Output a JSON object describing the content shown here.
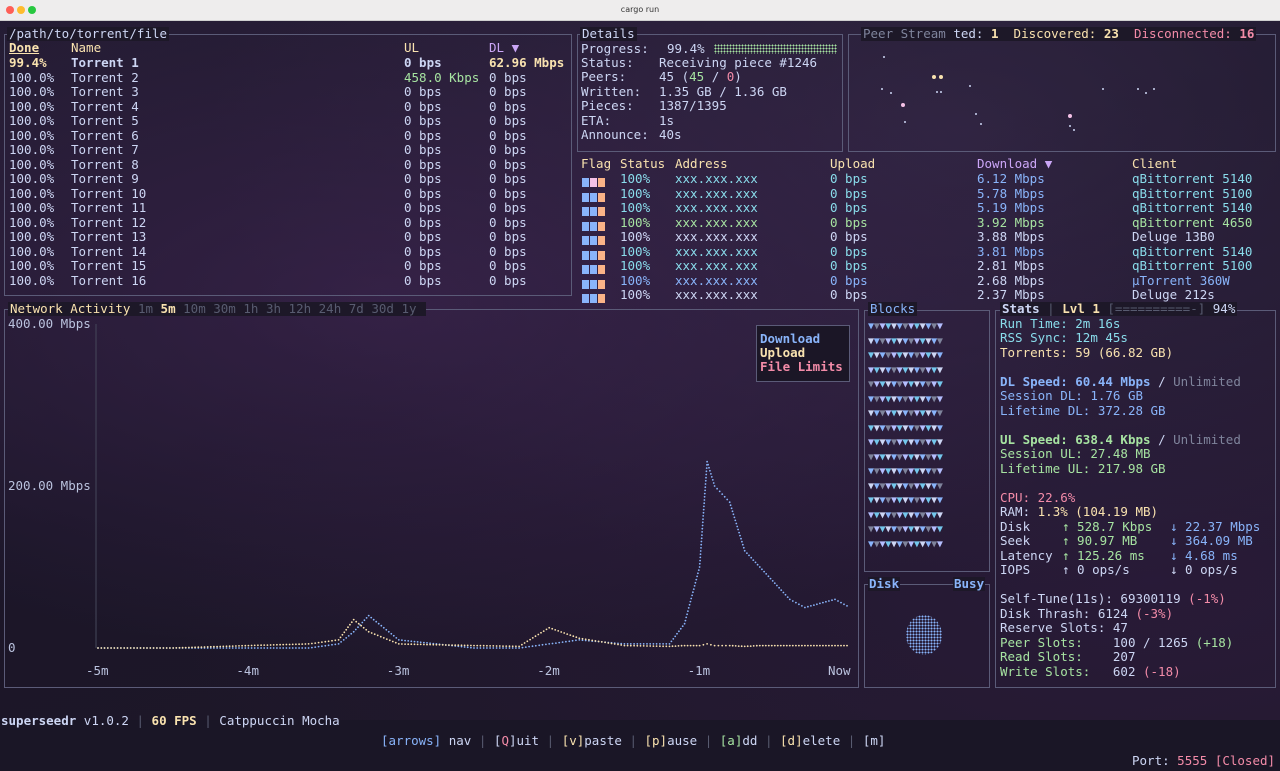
{
  "window": {
    "title": "cargo run"
  },
  "torrents": {
    "path": "/path/to/torrent/file",
    "headers": {
      "done": "Done",
      "name": "Name",
      "ul": "UL",
      "dl": "DL ▼"
    },
    "rows": [
      {
        "done": "99.4%",
        "name": "Torrent 1",
        "ul": "0 bps",
        "dl": "62.96 Mbps"
      },
      {
        "done": "100.0%",
        "name": "Torrent 2",
        "ul": "458.0 Kbps",
        "dl": "0 bps"
      },
      {
        "done": "100.0%",
        "name": "Torrent 3",
        "ul": "0 bps",
        "dl": "0 bps"
      },
      {
        "done": "100.0%",
        "name": "Torrent 4",
        "ul": "0 bps",
        "dl": "0 bps"
      },
      {
        "done": "100.0%",
        "name": "Torrent 5",
        "ul": "0 bps",
        "dl": "0 bps"
      },
      {
        "done": "100.0%",
        "name": "Torrent 6",
        "ul": "0 bps",
        "dl": "0 bps"
      },
      {
        "done": "100.0%",
        "name": "Torrent 7",
        "ul": "0 bps",
        "dl": "0 bps"
      },
      {
        "done": "100.0%",
        "name": "Torrent 8",
        "ul": "0 bps",
        "dl": "0 bps"
      },
      {
        "done": "100.0%",
        "name": "Torrent 9",
        "ul": "0 bps",
        "dl": "0 bps"
      },
      {
        "done": "100.0%",
        "name": "Torrent 10",
        "ul": "0 bps",
        "dl": "0 bps"
      },
      {
        "done": "100.0%",
        "name": "Torrent 11",
        "ul": "0 bps",
        "dl": "0 bps"
      },
      {
        "done": "100.0%",
        "name": "Torrent 12",
        "ul": "0 bps",
        "dl": "0 bps"
      },
      {
        "done": "100.0%",
        "name": "Torrent 13",
        "ul": "0 bps",
        "dl": "0 bps"
      },
      {
        "done": "100.0%",
        "name": "Torrent 14",
        "ul": "0 bps",
        "dl": "0 bps"
      },
      {
        "done": "100.0%",
        "name": "Torrent 15",
        "ul": "0 bps",
        "dl": "0 bps"
      },
      {
        "done": "100.0%",
        "name": "Torrent 16",
        "ul": "0 bps",
        "dl": "0 bps"
      }
    ]
  },
  "details": {
    "title": "Details",
    "progress_label": "Progress:",
    "progress_value": "99.4%",
    "progress_fraction": 0.994,
    "status_label": "Status:",
    "status_value": "Receiving piece #1246",
    "peers_label": "Peers:",
    "peers_a": "45",
    "peers_b": "45",
    "peers_c": "0",
    "written_label": "Written:",
    "written_value": "1.35 GB / 1.36 GB",
    "pieces_label": "Pieces:",
    "pieces_value": "1387/1395",
    "eta_label": "ETA:",
    "eta_value": "1s",
    "announce_label": "Announce:",
    "announce_value": "40s"
  },
  "peer_stream": {
    "title_prefix": "Peer Stream ",
    "connected_label": "ted:",
    "connected_value": "1",
    "discovered_label": "Discovered:",
    "discovered_value": "23",
    "disconnected_label": "Disconnected:",
    "disconnected_value": "16"
  },
  "peers_table": {
    "headers": {
      "flag": "Flag",
      "status": "Status",
      "address": "Address",
      "upload": "Upload",
      "download": "Download ▼",
      "client": "Client"
    },
    "rows": [
      {
        "status": "100%",
        "address": "xxx.xxx.xxx",
        "upload": "0 bps",
        "download": "6.12 Mbps",
        "client": "qBittorrent 5140"
      },
      {
        "status": "100%",
        "address": "xxx.xxx.xxx",
        "upload": "0 bps",
        "download": "5.78 Mbps",
        "client": "qBittorrent 5100"
      },
      {
        "status": "100%",
        "address": "xxx.xxx.xxx",
        "upload": "0 bps",
        "download": "5.19 Mbps",
        "client": "qBittorrent 5140"
      },
      {
        "status": "100%",
        "address": "xxx.xxx.xxx",
        "upload": "0 bps",
        "download": "3.92 Mbps",
        "client": "qBittorrent 4650"
      },
      {
        "status": "100%",
        "address": "xxx.xxx.xxx",
        "upload": "0 bps",
        "download": "3.88 Mbps",
        "client": "Deluge 13B0"
      },
      {
        "status": "100%",
        "address": "xxx.xxx.xxx",
        "upload": "0 bps",
        "download": "3.81 Mbps",
        "client": "qBittorrent 5140"
      },
      {
        "status": "100%",
        "address": "xxx.xxx.xxx",
        "upload": "0 bps",
        "download": "2.81 Mbps",
        "client": "qBittorrent 5100"
      },
      {
        "status": "100%",
        "address": "xxx.xxx.xxx",
        "upload": "0 bps",
        "download": "2.68 Mbps",
        "client": "µTorrent 360W"
      },
      {
        "status": "100%",
        "address": "xxx.xxx.xxx",
        "upload": "0 bps",
        "download": "2.37 Mbps",
        "client": "Deluge 212s"
      }
    ],
    "client_colors": [
      "#89dceb",
      "#89dceb",
      "#89dceb",
      "#a6e3a1",
      "#cdd6f4",
      "#89dceb",
      "#89dceb",
      "#89b4fa",
      "#cdd6f4"
    ],
    "download_colors": [
      "#89b4fa",
      "#89b4fa",
      "#89b4fa",
      "#a6e3a1",
      "#cdd6f4",
      "#89b4fa",
      "#cdd6f4",
      "#cdd6f4",
      "#cdd6f4"
    ]
  },
  "network": {
    "title": "Network Activity",
    "ranges": [
      "1m",
      "5m",
      "10m",
      "30m",
      "1h",
      "3h",
      "12h",
      "24h",
      "7d",
      "30d",
      "1y"
    ],
    "active_range": "5m",
    "legend": {
      "download": "Download",
      "upload": "Upload",
      "file_limits": "File Limits"
    }
  },
  "chart_data": {
    "type": "line",
    "xlabel": "",
    "ylabel": "",
    "x_ticks": [
      "-5m",
      "-4m",
      "-3m",
      "-2m",
      "-1m",
      "Now"
    ],
    "y_ticks": [
      "400.00 Mbps",
      "200.00 Mbps",
      "0"
    ],
    "ylim": [
      0,
      400
    ],
    "x_minutes": [
      -5.0,
      -4.5,
      -4.0,
      -3.6,
      -3.4,
      -3.3,
      -3.2,
      -3.0,
      -2.5,
      -2.2,
      -2.0,
      -1.8,
      -1.5,
      -1.2,
      -1.1,
      -1.0,
      -0.95,
      -0.9,
      -0.85,
      -0.8,
      -0.7,
      -0.6,
      -0.5,
      -0.4,
      -0.3,
      -0.2,
      -0.1,
      0.0
    ],
    "series": [
      {
        "name": "Download",
        "color": "#89b4fa",
        "values": [
          0,
          0,
          0,
          0,
          5,
          20,
          40,
          10,
          0,
          0,
          5,
          10,
          5,
          5,
          30,
          100,
          230,
          200,
          190,
          180,
          120,
          100,
          80,
          60,
          50,
          55,
          60,
          50
        ]
      },
      {
        "name": "Upload",
        "color": "#f9e2af",
        "values": [
          0,
          0,
          3,
          5,
          10,
          35,
          20,
          5,
          3,
          2,
          25,
          12,
          3,
          2,
          3,
          3,
          5,
          3,
          3,
          3,
          2,
          3,
          3,
          3,
          3,
          3,
          3,
          3
        ]
      }
    ]
  },
  "blocks": {
    "title": "Blocks",
    "glyph": "▼"
  },
  "disk_panel": {
    "left": "Disk",
    "right": "Busy"
  },
  "stats": {
    "title": "Stats",
    "lvl": "Lvl 1",
    "lvl_bar": "[==========-]",
    "lvl_pct": "94%",
    "run_time_label": "Run Time:",
    "run_time": "2m 16s",
    "rss_label": "RSS Sync:",
    "rss": "12m 45s",
    "torrents_label": "Torrents:",
    "torrents": "59 (66.82 GB)",
    "dl_speed_label": "DL Speed:",
    "dl_speed": "60.44 Mbps",
    "dl_limit": "Unlimited",
    "session_dl_label": "Session DL:",
    "session_dl": "1.76 GB",
    "lifetime_dl_label": "Lifetime DL:",
    "lifetime_dl": "372.28 GB",
    "ul_speed_label": "UL Speed:",
    "ul_speed": "638.4 Kbps",
    "ul_limit": "Unlimited",
    "session_ul_label": "Session UL:",
    "session_ul": "27.48 MB",
    "lifetime_ul_label": "Lifetime UL:",
    "lifetime_ul": "217.98 GB",
    "cpu_label": "CPU:",
    "cpu": "22.6%",
    "ram_label": "RAM:",
    "ram": "1.3% (104.19 MB)",
    "disk_label": "Disk",
    "disk_up": "↑ 528.7 Kbps",
    "disk_down": "↓ 22.37 Mbps",
    "seek_label": "Seek",
    "seek_up": "↑ 90.97 MB",
    "seek_down": "↓ 364.09 MB",
    "latency_label": "Latency",
    "latency_up": "↑ 125.26 ms",
    "latency_down": "↓ 4.68 ms",
    "iops_label": "IOPS",
    "iops_up": "↑ 0 ops/s",
    "iops_down": "↓ 0 ops/s",
    "selftune_label": "Self-Tune(11s):",
    "selftune": "69300119",
    "selftune_delta": "(-1%)",
    "thrash_label": "Disk Thrash:",
    "thrash": "6124",
    "thrash_delta": "(-3%)",
    "reserve_label": "Reserve Slots:",
    "reserve": "47",
    "peer_slots_label": "Peer Slots:",
    "peer_slots": "100 / 1265",
    "peer_slots_delta": "(+18)",
    "read_slots_label": "Read Slots:",
    "read_slots": "207",
    "write_slots_label": "Write Slots:",
    "write_slots": "602",
    "write_slots_delta": "(-18)"
  },
  "statusbar": {
    "app": "superseedr",
    "version": "v1.0.2",
    "fps": "60 FPS",
    "theme": "Catppuccin Mocha",
    "k_arrows": "[arrows]",
    "k_arrows_t": " nav",
    "k_q1": "[",
    "k_q2": "Q",
    "k_q3": "]uit",
    "k_v1": "[v]",
    "k_v2": "paste",
    "k_p1": "[p]",
    "k_p2": "ause",
    "k_a1": "[a]",
    "k_a2": "dd",
    "k_d1": "[d]",
    "k_d2": "elete",
    "k_m": "[m]",
    "port_label": "Port:",
    "port": "5555",
    "port_state": "[Closed]"
  }
}
